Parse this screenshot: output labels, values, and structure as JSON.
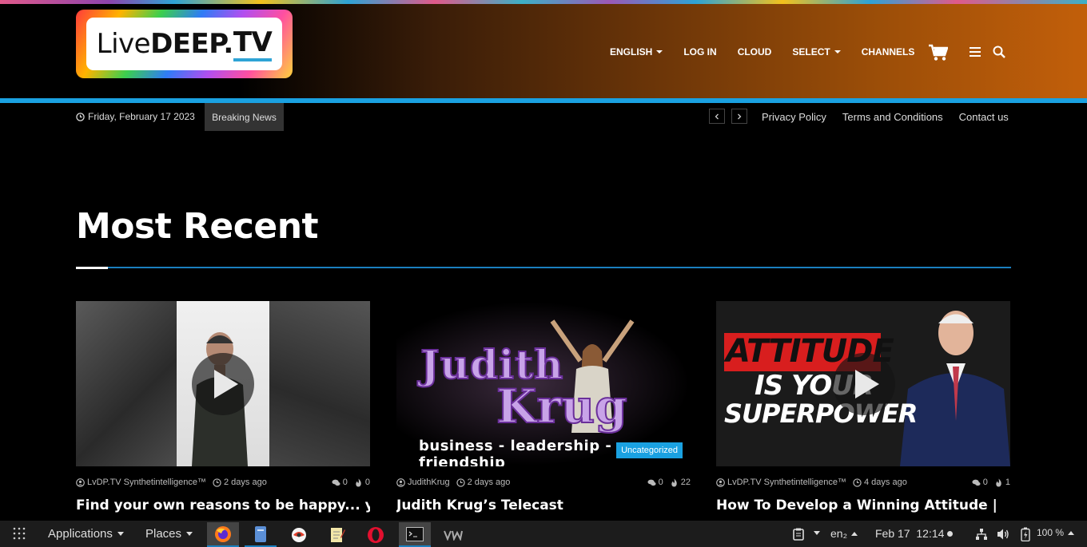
{
  "header": {
    "logo_text_a": "Live",
    "logo_text_b": "DEEP.",
    "logo_text_c": "TV",
    "nav": [
      {
        "label": "ENGLISH",
        "dropdown": true
      },
      {
        "label": "LOG IN",
        "dropdown": false
      },
      {
        "label": "CLOUD",
        "dropdown": false
      },
      {
        "label": "SELECT",
        "dropdown": true
      },
      {
        "label": "CHANNELS",
        "dropdown": false
      }
    ]
  },
  "subbar": {
    "date": "Friday, February 17 2023",
    "breaking": "Breaking News",
    "links": [
      "Privacy Policy",
      "Terms and Conditions",
      "Contact us"
    ]
  },
  "section": {
    "title": "Most Recent"
  },
  "cards": [
    {
      "author": "LvDP.TV Synthetintelligence™",
      "time": "2 days ago",
      "comments": "0",
      "views": "0",
      "title": "Find your own reasons to be happy... you"
    },
    {
      "author": "JudithKrug",
      "time": "2 days ago",
      "comments": "0",
      "views": "22",
      "title": "Judith Krug’s Telecast",
      "badge": "Uncategorized",
      "thumb_line1": "Judith",
      "thumb_line2": "Krug",
      "thumb_tagline": "business - leadership - friendship"
    },
    {
      "author": "LvDP.TV Synthetintelligence™",
      "time": "4 days ago",
      "comments": "0",
      "views": "1",
      "title": "How To Develop a Winning Attitude |",
      "thumb_line1": "ATTITUDE",
      "thumb_line2": "IS YOUR",
      "thumb_line3": "SUPERPOWER"
    }
  ],
  "taskbar": {
    "applications": "Applications",
    "places": "Places",
    "keyboard": "en₂",
    "clock": "Feb 17  12:14",
    "battery": "100 %"
  },
  "colors": {
    "accent": "#1aa1e1",
    "header_orange": "#c25f0a",
    "badge": "#1aa1e1"
  }
}
